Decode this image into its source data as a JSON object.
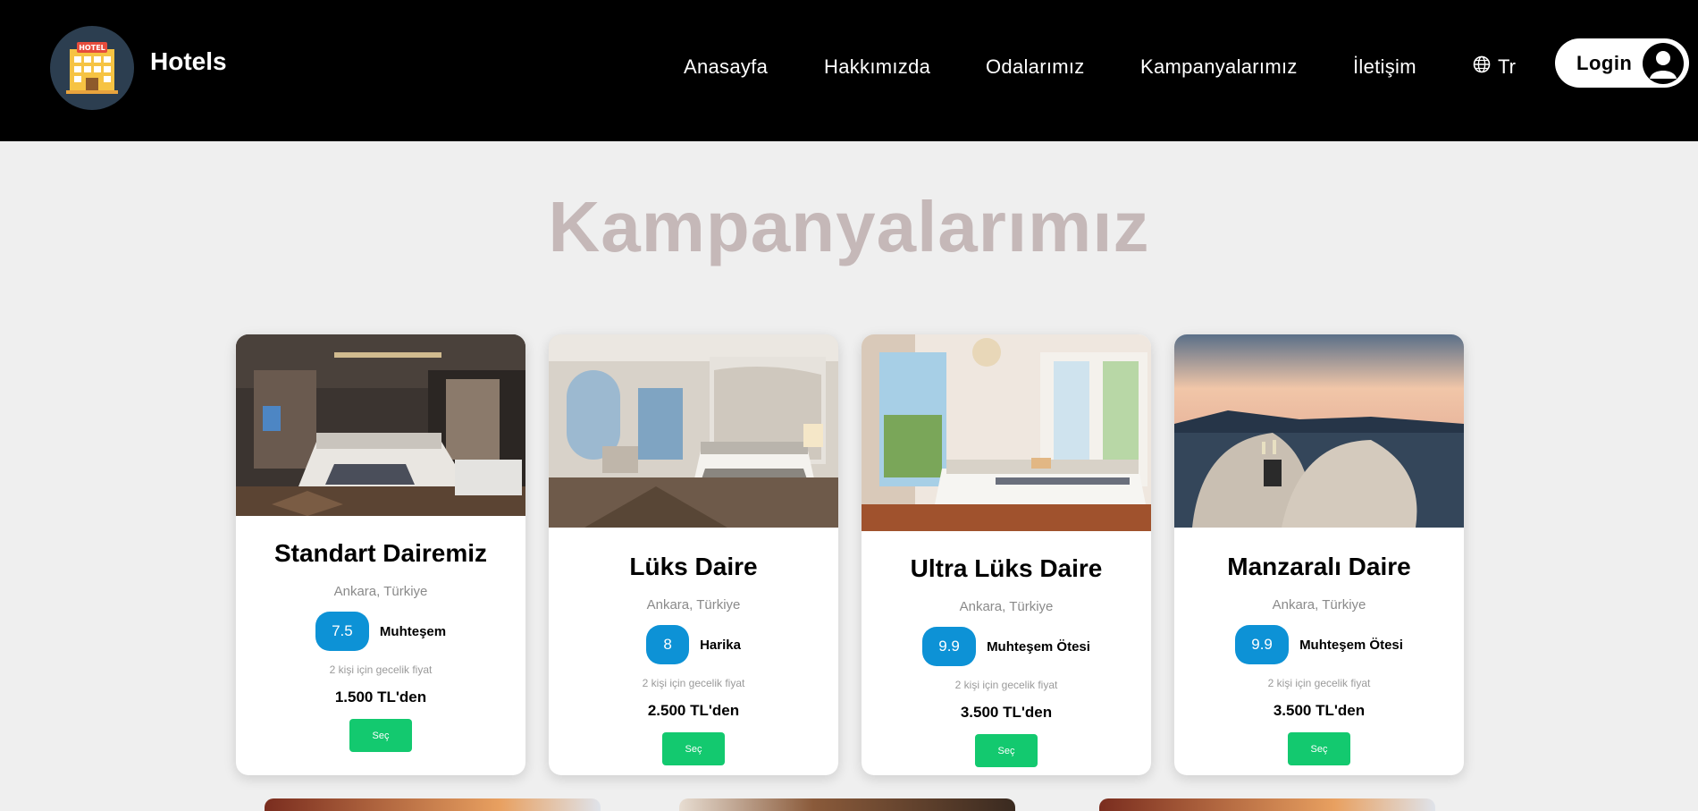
{
  "header": {
    "brand": "Hotels",
    "logo_icon": "hotel-building-icon",
    "nav": [
      {
        "label": "Anasayfa"
      },
      {
        "label": "Hakkımızda"
      },
      {
        "label": "Odalarımız"
      },
      {
        "label": "Kampanyalarımız"
      },
      {
        "label": "İletişim"
      }
    ],
    "language": {
      "label": "Tr",
      "icon": "globe-icon"
    },
    "login": {
      "label": "Login",
      "icon": "user-avatar-icon"
    }
  },
  "page_title": "Kampanyalarımız",
  "colors": {
    "header_bg": "#000000",
    "title": "#c5b8b8",
    "rating_badge": "#0d92d6",
    "select_button": "#13c96f"
  },
  "cards": [
    {
      "title": "Standart Dairemiz",
      "location": "Ankara, Türkiye",
      "rating": "7.5",
      "rating_label": "Muhteşem",
      "note": "2 kişi için gecelik fiyat",
      "price": "1.500 TL'den",
      "button": "Seç"
    },
    {
      "title": "Lüks Daire",
      "location": "Ankara, Türkiye",
      "rating": "8",
      "rating_label": "Harika",
      "note": "2 kişi için gecelik fiyat",
      "price": "2.500 TL'den",
      "button": "Seç"
    },
    {
      "title": "Ultra Lüks Daire",
      "location": "Ankara, Türkiye",
      "rating": "9.9",
      "rating_label": "Muhteşem Ötesi",
      "note": "2 kişi için gecelik fiyat",
      "price": "3.500 TL'den",
      "button": "Seç"
    },
    {
      "title": "Manzaralı Daire",
      "location": "Ankara, Türkiye",
      "rating": "9.9",
      "rating_label": "Muhteşem Ötesi",
      "note": "2 kişi için gecelik fiyat",
      "price": "3.500 TL'den",
      "button": "Seç"
    }
  ]
}
